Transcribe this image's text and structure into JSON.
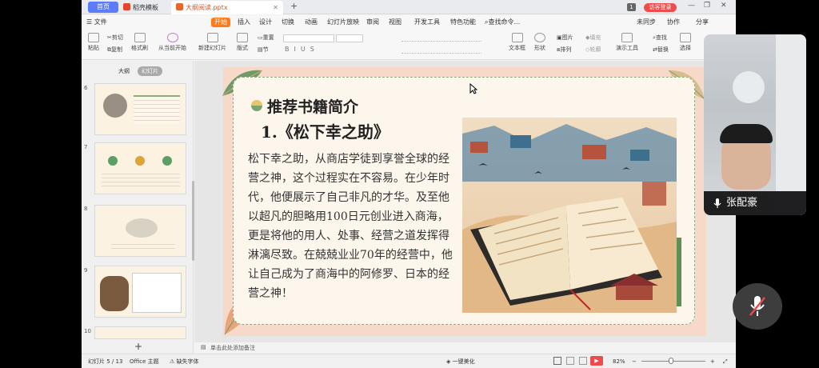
{
  "tabs": [
    {
      "label": "首页"
    },
    {
      "label": "稻壳模板"
    },
    {
      "label": "大纲阅读.pptx"
    }
  ],
  "titlebar": {
    "page_indicator": "1",
    "login": "访客登录"
  },
  "menu": [
    "文件",
    "开始",
    "插入",
    "设计",
    "切换",
    "动画",
    "幻灯片放映",
    "审阅",
    "视图",
    "开发工具",
    "特色功能"
  ],
  "search_placeholder": "查找命令...",
  "right_menu": {
    "sync": "未同步",
    "collab": "协作",
    "share": "分享"
  },
  "ribbon": {
    "cut": "剪切",
    "copy": "复制",
    "paste": "粘贴",
    "format_painter": "格式刷",
    "from_current": "从当前开始",
    "new_slide": "新建幻灯片",
    "layout": "版式",
    "reset": "重置",
    "section": "节",
    "textbox": "文本框",
    "shape": "形状",
    "arrange": "排列",
    "picture": "图片",
    "fill": "填充",
    "outline": "轮廓",
    "slideshow": "演示工具",
    "find": "查找",
    "replace": "替换",
    "select": "选择"
  },
  "panel_tabs": [
    "大纲",
    "幻灯片"
  ],
  "thumbnails": [
    "6",
    "7",
    "8",
    "9",
    "10"
  ],
  "slide": {
    "heading": "推荐书籍简介",
    "book_title": "1.《松下幸之助》",
    "paragraph": "松下幸之助，从商店学徒到享誉全球的经营之神，这个过程实在不容易。在少年时代，他便展示了自己非凡的才华。及至他以超凡的胆略用100日元创业进入商海，更是将他的用人、处事、经营之道发挥得淋漓尽致。在兢兢业业70年的经营中，他让自己成为了商海中的阿修罗、日本的经营之神！"
  },
  "notes_placeholder": "单击此处添加备注",
  "status": {
    "slide_count": "幻灯片 5 / 13",
    "theme": "Office 主题",
    "font_missing": "缺失字体",
    "beautify": "一键美化",
    "zoom": "82%"
  },
  "video": {
    "participant_name": "张配豪"
  },
  "colors": {
    "accent": "#ff7a1a",
    "slide_bg": "#fcf6ec",
    "slide_border": "#8bab79",
    "slide_outer": "#f6d9c9"
  }
}
